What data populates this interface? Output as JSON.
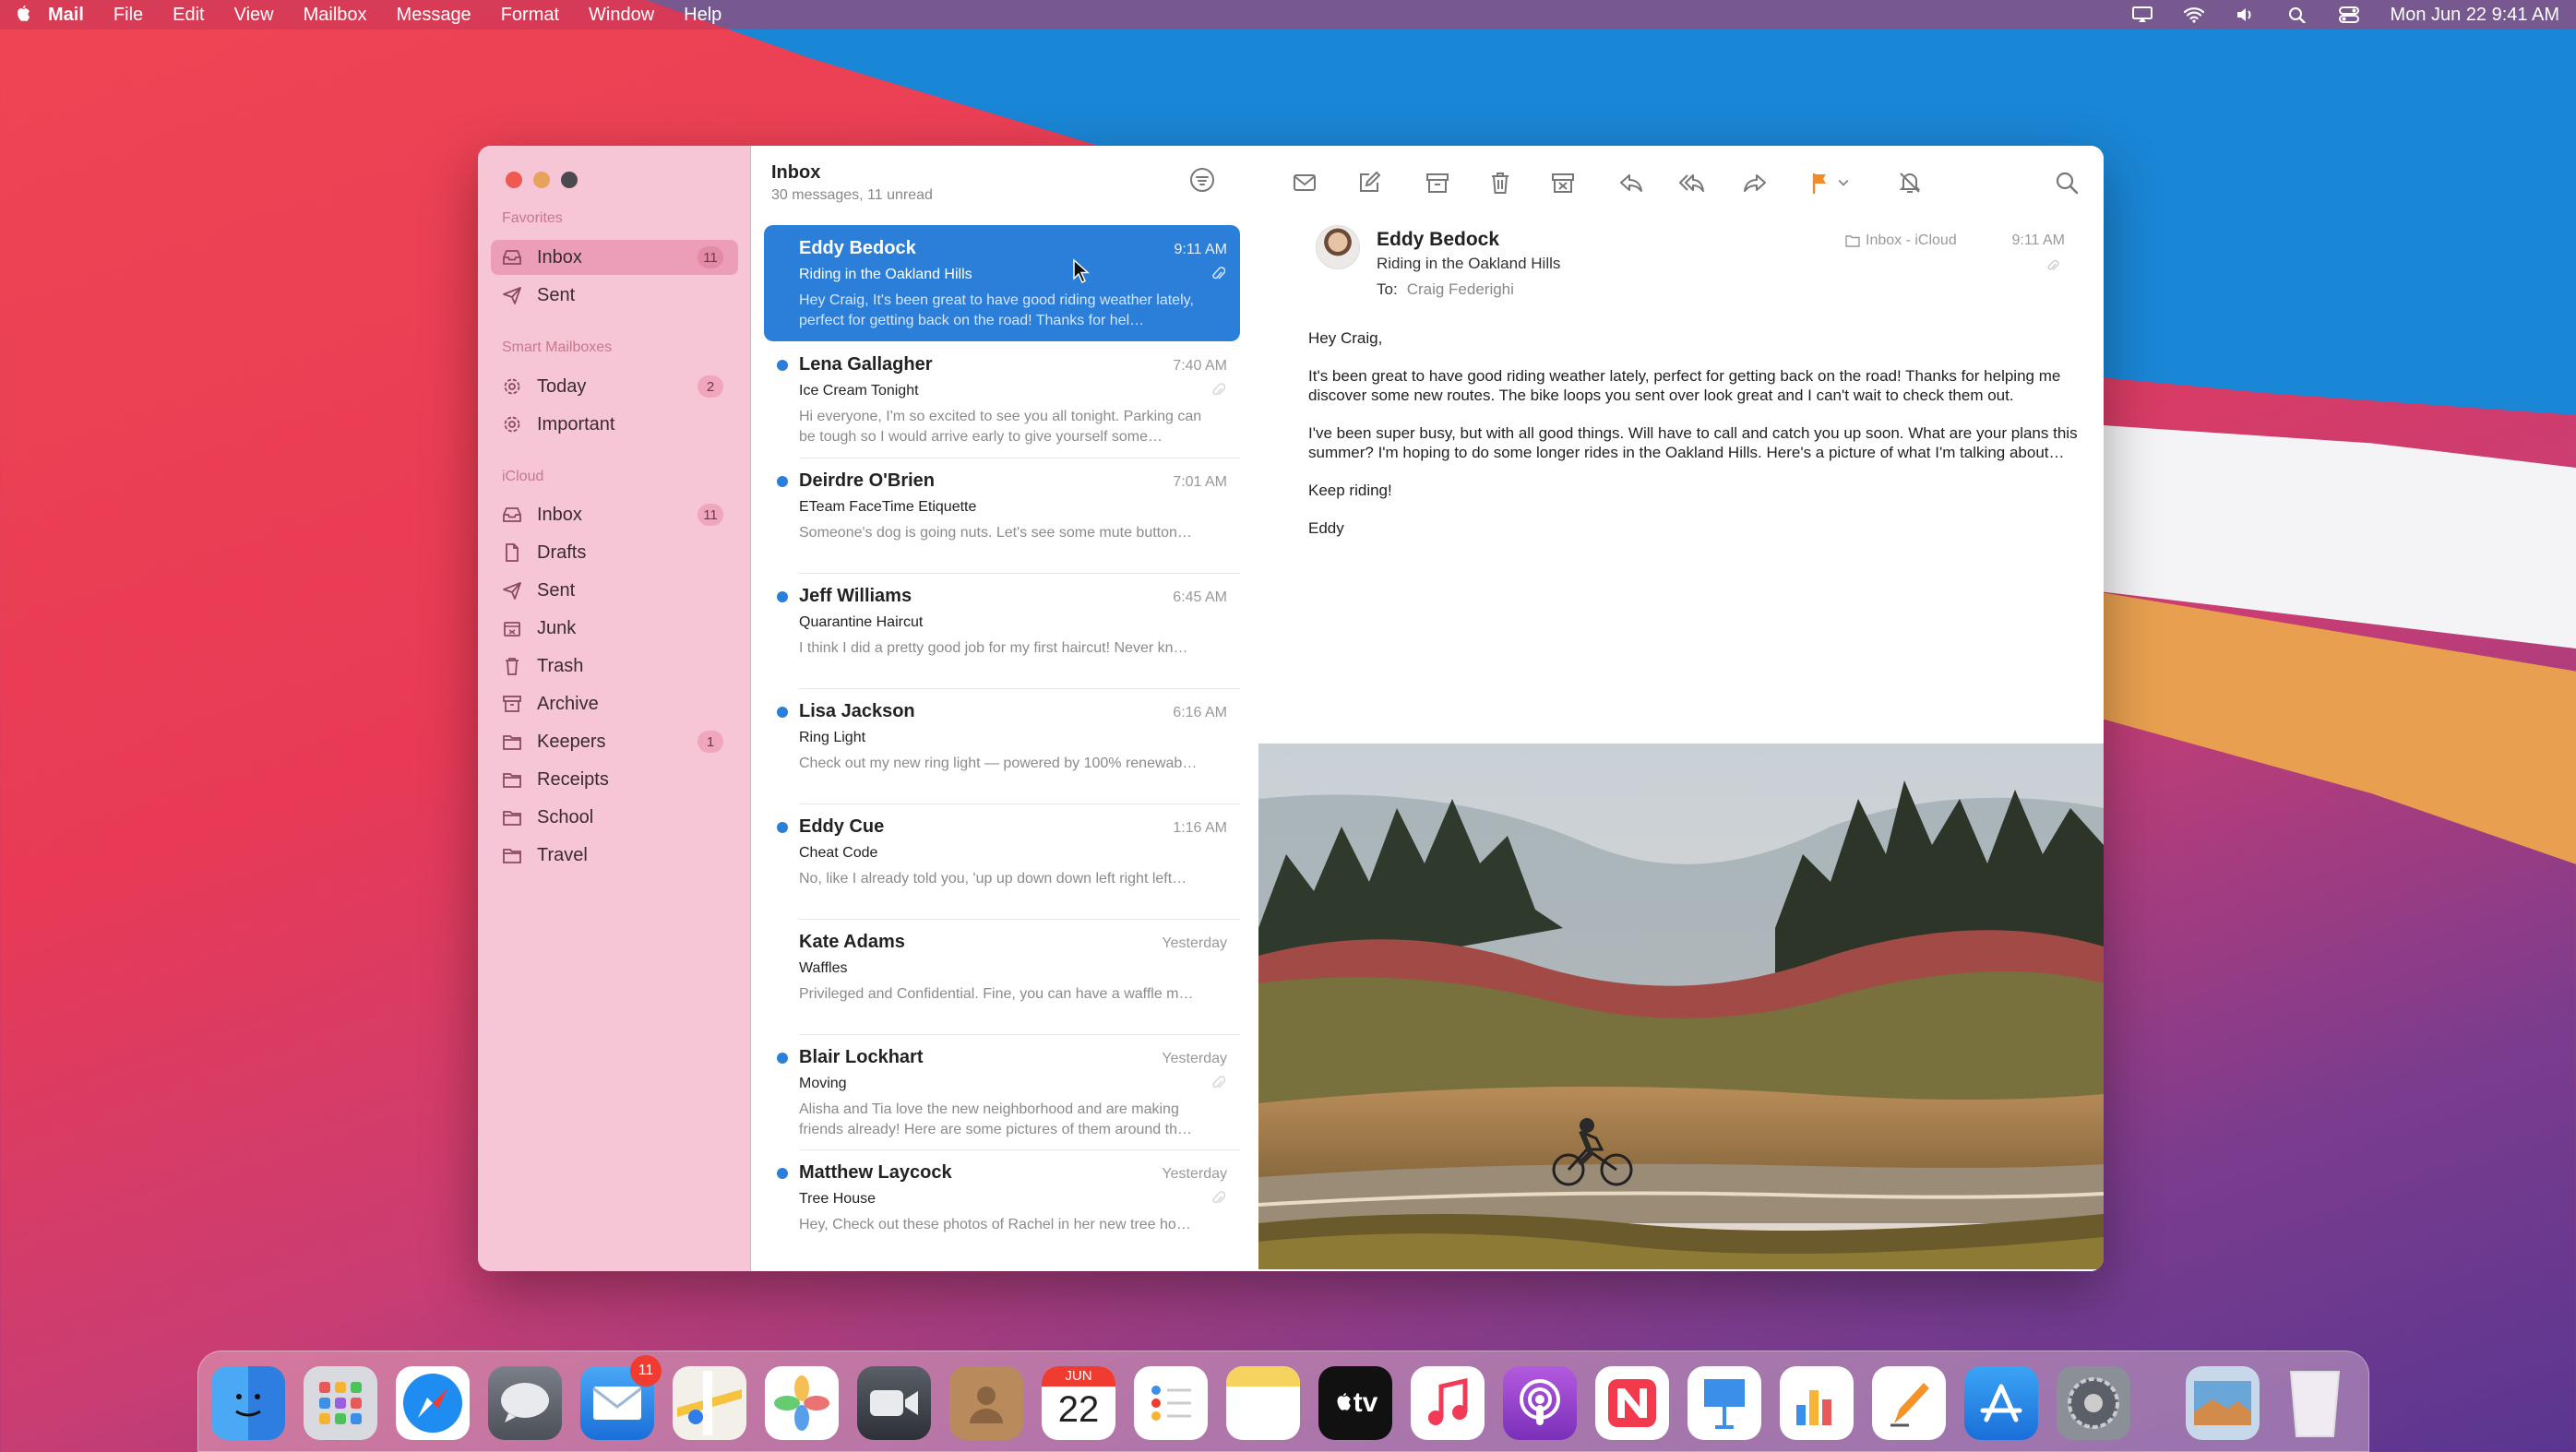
{
  "menubar": {
    "app": "Mail",
    "items": [
      "File",
      "Edit",
      "View",
      "Mailbox",
      "Message",
      "Format",
      "Window",
      "Help"
    ],
    "datetime": "Mon Jun 22  9:41 AM"
  },
  "sidebar": {
    "favorites_label": "Favorites",
    "favorites": [
      {
        "label": "Inbox",
        "badge": "11",
        "icon": "inbox-icon"
      },
      {
        "label": "Sent",
        "badge": "",
        "icon": "paperplane-icon"
      }
    ],
    "smart_label": "Smart Mailboxes",
    "smart": [
      {
        "label": "Today",
        "badge": "2",
        "icon": "gear-icon"
      },
      {
        "label": "Important",
        "badge": "",
        "icon": "gear-icon"
      }
    ],
    "icloud_label": "iCloud",
    "icloud": [
      {
        "label": "Inbox",
        "badge": "11",
        "icon": "inbox-icon"
      },
      {
        "label": "Drafts",
        "badge": "",
        "icon": "document-icon"
      },
      {
        "label": "Sent",
        "badge": "",
        "icon": "paperplane-icon"
      },
      {
        "label": "Junk",
        "badge": "",
        "icon": "junk-icon"
      },
      {
        "label": "Trash",
        "badge": "",
        "icon": "trash-icon"
      },
      {
        "label": "Archive",
        "badge": "",
        "icon": "archive-icon"
      },
      {
        "label": "Keepers",
        "badge": "1",
        "icon": "folder-icon"
      },
      {
        "label": "Receipts",
        "badge": "",
        "icon": "folder-icon"
      },
      {
        "label": "School",
        "badge": "",
        "icon": "folder-icon"
      },
      {
        "label": "Travel",
        "badge": "",
        "icon": "folder-icon"
      }
    ]
  },
  "list": {
    "title": "Inbox",
    "subtitle": "30 messages, 11 unread",
    "messages": [
      {
        "from": "Eddy Bedock",
        "time": "9:11 AM",
        "subject": "Riding in the Oakland Hills",
        "preview": "Hey Craig, It's been great to have good riding weather lately, perfect for getting back on the road! Thanks for hel…"
      },
      {
        "from": "Lena Gallagher",
        "time": "7:40 AM",
        "subject": "Ice Cream Tonight",
        "preview": "Hi everyone, I'm so excited to see you all tonight. Parking can be tough so I would arrive early to give yourself some…"
      },
      {
        "from": "Deirdre O'Brien",
        "time": "7:01 AM",
        "subject": "ETeam FaceTime Etiquette",
        "preview": "Someone's dog is going nuts. Let's see some mute button…"
      },
      {
        "from": "Jeff Williams",
        "time": "6:45 AM",
        "subject": "Quarantine Haircut",
        "preview": "I think I did a pretty good job for my first haircut! Never kn…"
      },
      {
        "from": "Lisa Jackson",
        "time": "6:16 AM",
        "subject": "Ring Light",
        "preview": "Check out my new ring light — powered by 100% renewab…"
      },
      {
        "from": "Eddy Cue",
        "time": "1:16 AM",
        "subject": "Cheat Code",
        "preview": "No, like I already told you, 'up up down down left right left…"
      },
      {
        "from": "Kate Adams",
        "time": "Yesterday",
        "subject": "Waffles",
        "preview": "Privileged and Confidential. Fine, you can have a waffle m…"
      },
      {
        "from": "Blair Lockhart",
        "time": "Yesterday",
        "subject": "Moving",
        "preview": "Alisha and Tia love the new neighborhood and are making friends already! Here are some pictures of them around th…"
      },
      {
        "from": "Matthew Laycock",
        "time": "Yesterday",
        "subject": "Tree House",
        "preview": "Hey, Check out these photos of Rachel in her new tree ho…"
      }
    ]
  },
  "reader": {
    "from": "Eddy Bedock",
    "subject": "Riding in the Oakland Hills",
    "to_label": "To:",
    "to": "Craig Federighi",
    "mailbox": "Inbox - iCloud",
    "time": "9:11 AM",
    "body": [
      "Hey Craig,",
      "It's been great to have good riding weather lately, perfect for getting back on the road! Thanks for helping me discover some new routes. The bike loops you sent over look great and I can't wait to check them out.",
      "I've been super busy, but with all good things. Will have to call and catch you up soon. What are your plans this summer? I'm hoping to do some longer rides in the Oakland Hills. Here's a picture of what I'm talking about…",
      "Keep riding!",
      "Eddy"
    ]
  },
  "dock": {
    "mail_badge": "11",
    "calendar_month": "JUN",
    "calendar_day": "22",
    "tv_label": "tv"
  },
  "colors": {
    "accent": "#2b7fd9",
    "sidebar": "#f6c5d6",
    "flag": "#f08c2a"
  }
}
